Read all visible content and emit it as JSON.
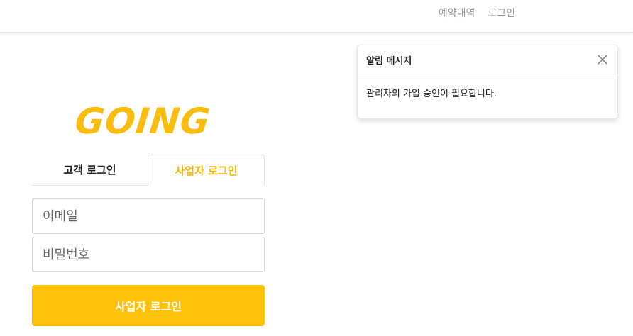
{
  "header": {
    "nav": {
      "reservations": "예약내역",
      "login": "로그인"
    }
  },
  "logo": {
    "text": "GOING"
  },
  "tabs": {
    "customer": "고객 로그인",
    "business": "사업자 로그인"
  },
  "form": {
    "email_placeholder": "이메일",
    "password_placeholder": "비밀번호",
    "submit_label": "사업자 로그인"
  },
  "toast": {
    "title": "알림 메시지",
    "message": "관리자의 가입 승인이 필요합니다.",
    "close_icon": "close-icon"
  },
  "colors": {
    "brand": "#fec20b",
    "active_tab": "#f5b800",
    "muted_text": "#9a9a9a"
  }
}
